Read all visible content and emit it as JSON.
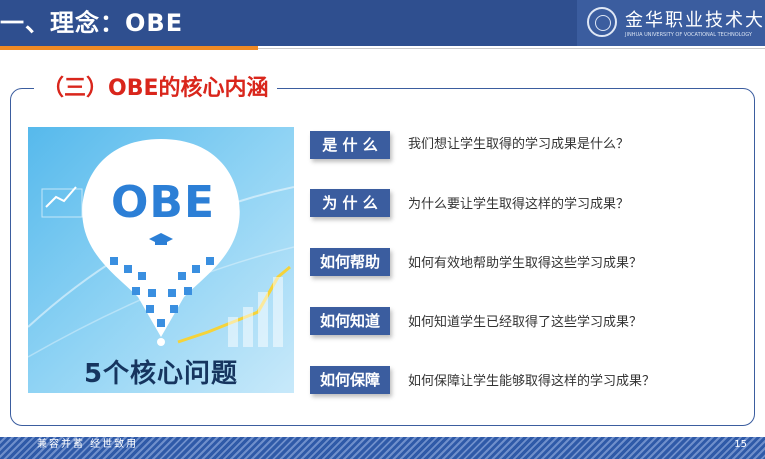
{
  "header": {
    "title": "一、理念：OBE",
    "school_name_cn": "金华职业技术大学",
    "school_name_en": "JINHUA UNIVERSITY OF VOCATIONAL TECHNOLOGY"
  },
  "section": {
    "subtitle": "（三）OBE的核心内涵"
  },
  "illustration": {
    "obe_text": "OBE",
    "caption": "5个核心问题"
  },
  "questions": [
    {
      "label": "是 什 么",
      "text": "我们想让学生取得的学习成果是什么？"
    },
    {
      "label": "为 什 么",
      "text": "为什么要让学生取得这样的学习成果？"
    },
    {
      "label": "如何帮助",
      "text": "如何有效地帮助学生取得这些学习成果？"
    },
    {
      "label": "如何知道",
      "text": "如何知道学生已经取得了这些学习成果？"
    },
    {
      "label": "如何保障",
      "text": "如何保障让学生能够取得这样的学习成果？"
    }
  ],
  "footer": {
    "motto": "兼容并蓄 经世致用",
    "page_number": "15"
  },
  "colors": {
    "header_blue": "#2f4f8f",
    "accent_orange": "#f08a24",
    "subtitle_red": "#d9261c",
    "label_blue": "#3b5d9f"
  }
}
